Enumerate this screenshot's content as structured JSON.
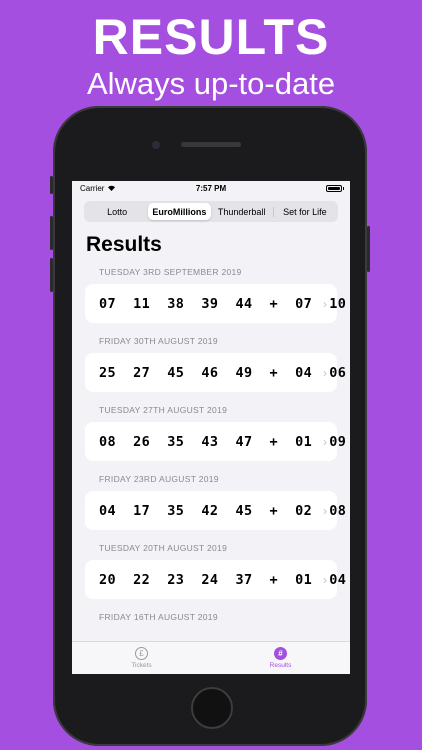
{
  "promo": {
    "headline": "RESULTS",
    "subheadline": "Always up-to-date"
  },
  "status_bar": {
    "carrier": "Carrier",
    "time": "7:57 PM"
  },
  "segmented_control": {
    "items": [
      "Lotto",
      "EuroMillions",
      "Thunderball",
      "Set for Life"
    ],
    "selected": "EuroMillions"
  },
  "page": {
    "title": "Results"
  },
  "results": [
    {
      "date": "TUESDAY 3RD SEPTEMBER 2019",
      "numbers": "07  11  38  39  44  +  07  10"
    },
    {
      "date": "FRIDAY 30TH AUGUST 2019",
      "numbers": "25  27  45  46  49  +  04  06"
    },
    {
      "date": "TUESDAY 27TH AUGUST 2019",
      "numbers": "08  26  35  43  47  +  01  09"
    },
    {
      "date": "FRIDAY 23RD AUGUST 2019",
      "numbers": "04  17  35  42  45  +  02  08"
    },
    {
      "date": "TUESDAY 20TH AUGUST 2019",
      "numbers": "20  22  23  24  37  +  01  04"
    },
    {
      "date": "FRIDAY 16TH AUGUST 2019",
      "numbers": ""
    }
  ],
  "tab_bar": {
    "tabs": [
      {
        "label": "Tickets",
        "icon": "pound-coin-icon",
        "glyph": "£"
      },
      {
        "label": "Results",
        "icon": "hash-icon",
        "glyph": "#"
      }
    ],
    "active": "Results"
  },
  "colors": {
    "accent": "#a54fe0"
  }
}
